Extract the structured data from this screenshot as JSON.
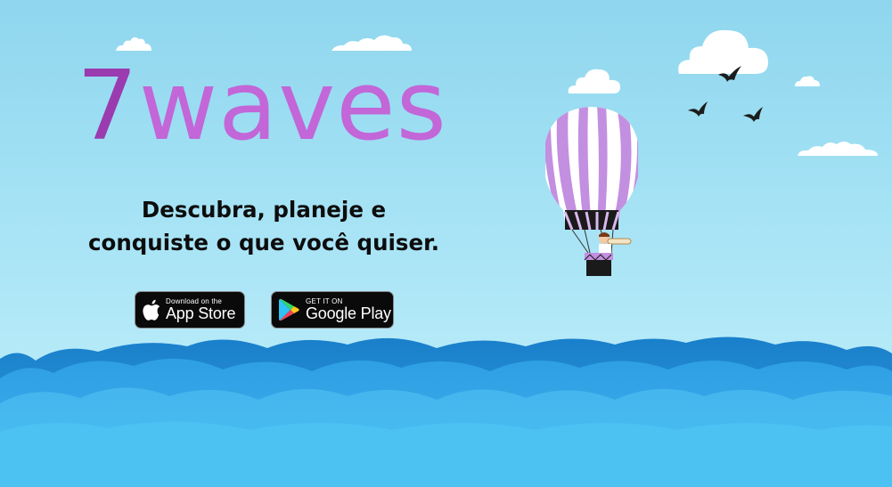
{
  "brand": {
    "seven": "7",
    "rest": "waves",
    "seven_color": "#9a3bb0",
    "rest_color": "#c266d8"
  },
  "tagline": {
    "line1": "Descubra, planeje e",
    "line2": "conquiste o que você quiser."
  },
  "buttons": {
    "app_store": {
      "small": "Download on the",
      "big": "App Store",
      "icon": "apple-icon"
    },
    "google_play": {
      "small": "GET IT ON",
      "big": "Google Play",
      "icon": "google-play-icon"
    }
  },
  "colors": {
    "sky": "#a6e3f5",
    "wave_dark": "#1f8fd8",
    "wave_light": "#45b8ee",
    "balloon_stripe": "#c38fe0"
  }
}
